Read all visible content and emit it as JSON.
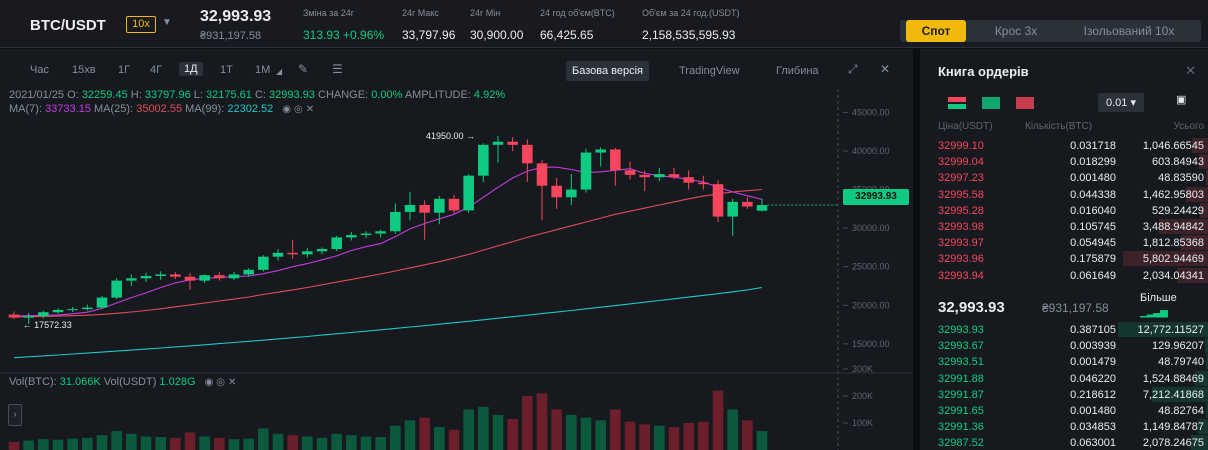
{
  "header": {
    "pair": "BTC/USDT",
    "leverage": "10x",
    "last_price": "32,993.93",
    "last_price_uah": "₴931,197.58",
    "stats": [
      {
        "label": "Зміна за 24г",
        "value": "313.93 +0.96%",
        "positive": true
      },
      {
        "label": "24г Макс",
        "value": "33,797.96"
      },
      {
        "label": "24г Мін",
        "value": "30,900.00"
      },
      {
        "label": "24 год об'єм(BTC)",
        "value": "66,425.65"
      },
      {
        "label": "Об'єм за 24 год.(USDT)",
        "value": "2,158,535,595.93"
      }
    ],
    "modes": [
      "Спот",
      "Крос 3х",
      "Ізольований 10х"
    ],
    "active_mode": "Спот"
  },
  "toolbar": {
    "timeframes": [
      "Час",
      "15хв",
      "1Г",
      "4Г",
      "1Д",
      "1Т",
      "1М"
    ],
    "active_timeframe": "1Д",
    "views": [
      "Базова версія",
      "TradingView",
      "Глибина"
    ],
    "active_view": "Базова версія"
  },
  "info": {
    "date": "2021/01/25",
    "o_label": "O:",
    "o": "32259.45",
    "h_label": "H:",
    "h": "33797.96",
    "l_label": "L:",
    "l": "32175.61",
    "c_label": "C:",
    "c": "32993.93",
    "change_label": "CHANGE:",
    "change": "0.00%",
    "amp_label": "AMPLITUDE:",
    "amp": "4.92%",
    "ma7_label": "MA(7):",
    "ma7": "33733.15",
    "ma25_label": "MA(25):",
    "ma25": "35002.55",
    "ma99_label": "MA(99):",
    "ma99": "22302.52",
    "vol_btc_label": "Vol(BTC):",
    "vol_btc": "31.066K",
    "vol_usdt_label": "Vol(USDT)",
    "vol_usdt": "1.028G"
  },
  "chart": {
    "price_axis": [
      "45000.00",
      "40000.00",
      "35000.00",
      "30000.00",
      "25000.00",
      "20000.00",
      "15000.00"
    ],
    "vol_axis": [
      "300K",
      "200K",
      "100K"
    ],
    "current_price_tag": "32993.93",
    "high_label": "41950.00",
    "low_label": "17572.33"
  },
  "chart_data": {
    "type": "candlestick",
    "y_range": [
      12000,
      47000
    ],
    "candles": [
      {
        "o": 18800,
        "h": 19200,
        "l": 18200,
        "c": 18400
      },
      {
        "o": 18400,
        "h": 19000,
        "l": 17572,
        "c": 18600
      },
      {
        "o": 18600,
        "h": 19300,
        "l": 18300,
        "c": 19100
      },
      {
        "o": 19100,
        "h": 19600,
        "l": 18900,
        "c": 19400
      },
      {
        "o": 19400,
        "h": 19800,
        "l": 19100,
        "c": 19500
      },
      {
        "o": 19500,
        "h": 20100,
        "l": 19300,
        "c": 19700
      },
      {
        "o": 19700,
        "h": 21200,
        "l": 19600,
        "c": 21000
      },
      {
        "o": 21000,
        "h": 23500,
        "l": 20800,
        "c": 23200
      },
      {
        "o": 23200,
        "h": 24000,
        "l": 22500,
        "c": 23500
      },
      {
        "o": 23500,
        "h": 24200,
        "l": 23000,
        "c": 23800
      },
      {
        "o": 23800,
        "h": 24400,
        "l": 23300,
        "c": 24000
      },
      {
        "o": 24000,
        "h": 24300,
        "l": 23400,
        "c": 23700
      },
      {
        "o": 23700,
        "h": 24200,
        "l": 22000,
        "c": 23200
      },
      {
        "o": 23200,
        "h": 24000,
        "l": 22900,
        "c": 23900
      },
      {
        "o": 23900,
        "h": 24300,
        "l": 23200,
        "c": 23500
      },
      {
        "o": 23500,
        "h": 24300,
        "l": 23300,
        "c": 24000
      },
      {
        "o": 24000,
        "h": 24800,
        "l": 23700,
        "c": 24600
      },
      {
        "o": 24600,
        "h": 26500,
        "l": 24400,
        "c": 26300
      },
      {
        "o": 26300,
        "h": 27300,
        "l": 25800,
        "c": 26800
      },
      {
        "o": 26800,
        "h": 28500,
        "l": 26000,
        "c": 26600
      },
      {
        "o": 26600,
        "h": 27400,
        "l": 26200,
        "c": 27000
      },
      {
        "o": 27000,
        "h": 27500,
        "l": 26600,
        "c": 27300
      },
      {
        "o": 27300,
        "h": 29000,
        "l": 27000,
        "c": 28800
      },
      {
        "o": 28800,
        "h": 29500,
        "l": 28400,
        "c": 29100
      },
      {
        "o": 29100,
        "h": 29600,
        "l": 28700,
        "c": 29300
      },
      {
        "o": 29300,
        "h": 29800,
        "l": 28800,
        "c": 29600
      },
      {
        "o": 29600,
        "h": 33200,
        "l": 29300,
        "c": 32100
      },
      {
        "o": 32100,
        "h": 34700,
        "l": 31000,
        "c": 33000
      },
      {
        "o": 33000,
        "h": 33600,
        "l": 28500,
        "c": 32000
      },
      {
        "o": 32000,
        "h": 34200,
        "l": 30500,
        "c": 33800
      },
      {
        "o": 33800,
        "h": 34300,
        "l": 31900,
        "c": 32300
      },
      {
        "o": 32300,
        "h": 37000,
        "l": 32000,
        "c": 36800
      },
      {
        "o": 36800,
        "h": 41000,
        "l": 36000,
        "c": 40800
      },
      {
        "o": 40800,
        "h": 41950,
        "l": 38500,
        "c": 41200
      },
      {
        "o": 41200,
        "h": 41800,
        "l": 40000,
        "c": 40800
      },
      {
        "o": 40800,
        "h": 41500,
        "l": 36000,
        "c": 38400
      },
      {
        "o": 38400,
        "h": 38800,
        "l": 31000,
        "c": 35500
      },
      {
        "o": 35500,
        "h": 36500,
        "l": 32500,
        "c": 34000
      },
      {
        "o": 34000,
        "h": 37000,
        "l": 33000,
        "c": 35000
      },
      {
        "o": 35000,
        "h": 40300,
        "l": 34600,
        "c": 39800
      },
      {
        "o": 39800,
        "h": 40500,
        "l": 38000,
        "c": 40200
      },
      {
        "o": 40200,
        "h": 40400,
        "l": 35500,
        "c": 37500
      },
      {
        "o": 37500,
        "h": 38600,
        "l": 36300,
        "c": 36900
      },
      {
        "o": 36900,
        "h": 37500,
        "l": 34800,
        "c": 36600
      },
      {
        "o": 36600,
        "h": 37800,
        "l": 36100,
        "c": 37000
      },
      {
        "o": 37000,
        "h": 37800,
        "l": 36300,
        "c": 36600
      },
      {
        "o": 36600,
        "h": 37500,
        "l": 35000,
        "c": 35900
      },
      {
        "o": 35900,
        "h": 36800,
        "l": 35000,
        "c": 35700
      },
      {
        "o": 35700,
        "h": 36200,
        "l": 30800,
        "c": 31500
      },
      {
        "o": 31500,
        "h": 33800,
        "l": 29000,
        "c": 33400
      },
      {
        "o": 33400,
        "h": 34000,
        "l": 32500,
        "c": 32800
      },
      {
        "o": 32259,
        "h": 33798,
        "l": 32176,
        "c": 32994
      }
    ],
    "volumes": [
      30,
      35,
      40,
      38,
      42,
      45,
      55,
      70,
      60,
      50,
      48,
      45,
      65,
      50,
      45,
      40,
      42,
      80,
      60,
      55,
      50,
      45,
      60,
      55,
      50,
      48,
      90,
      110,
      120,
      85,
      75,
      150,
      160,
      130,
      115,
      200,
      210,
      150,
      130,
      120,
      110,
      150,
      105,
      95,
      90,
      85,
      100,
      105,
      220,
      150,
      110,
      70
    ],
    "ma7": [
      18600,
      18650,
      18700,
      18750,
      18900,
      19100,
      19600,
      20300,
      21000,
      21600,
      22300,
      22900,
      23300,
      23500,
      23600,
      23700,
      23800,
      24100,
      24500,
      25000,
      25400,
      25900,
      26400,
      27100,
      27600,
      28000,
      28900,
      29900,
      30600,
      31200,
      31800,
      32700,
      34000,
      35300,
      36500,
      37400,
      37900,
      37900,
      37600,
      37200,
      37300,
      37500,
      37700,
      37100,
      36800,
      36600,
      36300,
      36000,
      35300,
      34700,
      34200,
      33733
    ],
    "ma25": [
      18500,
      18520,
      18560,
      18600,
      18650,
      18720,
      18820,
      18960,
      19130,
      19330,
      19550,
      19800,
      20050,
      20300,
      20550,
      20800,
      21080,
      21400,
      21700,
      22000,
      22300,
      22650,
      23000,
      23350,
      23700,
      24050,
      24450,
      24850,
      25250,
      25650,
      26100,
      26600,
      27150,
      27700,
      28250,
      28800,
      29300,
      29800,
      30300,
      30800,
      31300,
      31800,
      32200,
      32600,
      33000,
      33400,
      33800,
      34150,
      34450,
      34700,
      34850,
      35003
    ],
    "ma99": [
      13200,
      13320,
      13440,
      13560,
      13680,
      13800,
      13930,
      14060,
      14190,
      14320,
      14460,
      14600,
      14740,
      14880,
      15030,
      15180,
      15330,
      15480,
      15640,
      15800,
      15960,
      16130,
      16300,
      16470,
      16640,
      16820,
      17000,
      17180,
      17360,
      17550,
      17740,
      17930,
      18120,
      18320,
      18520,
      18720,
      18920,
      19120,
      19330,
      19540,
      19750,
      19960,
      20180,
      20400,
      20620,
      20840,
      21060,
      21280,
      21500,
      21750,
      22000,
      22303
    ]
  },
  "orderbook": {
    "title": "Книга ордерів",
    "precision": "0.01",
    "headers": [
      "Ціна(USDT)",
      "Кількість(BTC)",
      "Усього"
    ],
    "asks": [
      {
        "price": "32999.10",
        "qty": "0.031718",
        "total": "1,046.66545",
        "depth": 0.18
      },
      {
        "price": "32999.04",
        "qty": "0.018299",
        "total": "603.84943",
        "depth": 0.1
      },
      {
        "price": "32997.23",
        "qty": "0.001480",
        "total": "48.83590",
        "depth": 0.02
      },
      {
        "price": "32995.58",
        "qty": "0.044338",
        "total": "1,462.95803",
        "depth": 0.25
      },
      {
        "price": "32995.28",
        "qty": "0.016040",
        "total": "529.24429",
        "depth": 0.09
      },
      {
        "price": "32993.98",
        "qty": "0.105745",
        "total": "3,488.94842",
        "depth": 0.55
      },
      {
        "price": "32993.97",
        "qty": "0.054945",
        "total": "1,812.85368",
        "depth": 0.3
      },
      {
        "price": "32993.96",
        "qty": "0.175879",
        "total": "5,802.94469",
        "depth": 0.95
      },
      {
        "price": "32993.94",
        "qty": "0.061649",
        "total": "2,034.04341",
        "depth": 0.34
      }
    ],
    "last_price": "32,993.93",
    "last_price_uah": "₴931,197.58",
    "more_label": "Більше",
    "bids": [
      {
        "price": "32993.93",
        "qty": "0.387105",
        "total": "12,772.11527",
        "depth": 1.0
      },
      {
        "price": "32993.67",
        "qty": "0.003939",
        "total": "129.96207",
        "depth": 0.03
      },
      {
        "price": "32993.51",
        "qty": "0.001479",
        "total": "48.79740",
        "depth": 0.02
      },
      {
        "price": "32991.88",
        "qty": "0.046220",
        "total": "1,524.88469",
        "depth": 0.15
      },
      {
        "price": "32991.87",
        "qty": "0.218612",
        "total": "7,212.41868",
        "depth": 0.62
      },
      {
        "price": "32991.65",
        "qty": "0.001480",
        "total": "48.82764",
        "depth": 0.02
      },
      {
        "price": "32991.36",
        "qty": "0.034853",
        "total": "1,149.84787",
        "depth": 0.11
      },
      {
        "price": "32987.52",
        "qty": "0.063001",
        "total": "2,078.24675",
        "depth": 0.19
      }
    ]
  },
  "colors": {
    "up": "#0ecb81",
    "down": "#f6465d",
    "ma7": "#c63be0",
    "ma25": "#e04b5a",
    "ma99": "#1fc7c9",
    "accent": "#f0b90b"
  }
}
